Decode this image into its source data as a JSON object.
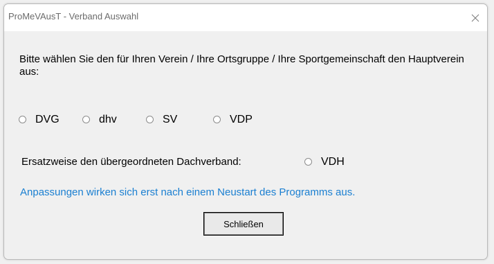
{
  "window": {
    "title": "ProMeVAusT - Verband Auswahl"
  },
  "instruction": "Bitte wählen Sie den für Ihren Verein / Ihre Ortsgruppe / Ihre Sportgemeinschaft den Hauptverein aus:",
  "main_options": [
    {
      "label": "DVG",
      "selected": false
    },
    {
      "label": "dhv",
      "selected": false
    },
    {
      "label": "SV",
      "selected": false
    },
    {
      "label": "VDP",
      "selected": false
    }
  ],
  "fallback": {
    "label": "Ersatzweise den übergeordneten Dachverband:",
    "option": {
      "label": "VDH",
      "selected": false
    }
  },
  "hint": "Anpassungen wirken sich erst nach einem Neustart des Programms aus.",
  "close_button_label": "Schließen",
  "colors": {
    "hint_text": "#1a7fd1",
    "window_bg": "#f0f0f0",
    "titlebar_bg": "#ffffff"
  },
  "icons": {
    "close": "close-icon",
    "radio": "radio-button-icon"
  }
}
